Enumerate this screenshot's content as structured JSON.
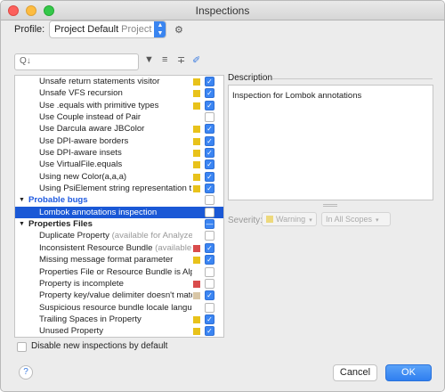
{
  "window": {
    "title": "Inspections"
  },
  "profile": {
    "label": "Profile:",
    "value": "Project Default",
    "sub": "Project"
  },
  "icons": {
    "gear": "gear-icon",
    "search": "search-icon",
    "filter": "filter-icon",
    "expand": "expand-all-icon",
    "collapse": "collapse-all-icon",
    "reset": "eraser-icon"
  },
  "toolbar": {
    "search_prefix": "Q↓",
    "filter_glyph": "▼",
    "expand_glyph": "≡",
    "collapse_glyph": "∓",
    "reset_glyph": "✐"
  },
  "colors": {
    "warning": "#e8c21b",
    "error": "#d94c4c",
    "weak_warning": "#d8c6a6",
    "selection": "#1a58d6",
    "group_link": "#1f5ae0",
    "accent": "#3b85f2"
  },
  "tree": [
    {
      "type": "item",
      "label": "Unsafe return statements visitor",
      "severity": "warning",
      "checked": true
    },
    {
      "type": "item",
      "label": "Unsafe VFS recursion",
      "severity": "warning",
      "checked": true
    },
    {
      "type": "item",
      "label": "Use .equals with primitive types",
      "severity": "warning",
      "checked": true
    },
    {
      "type": "item",
      "label": "Use Couple instead of Pair",
      "severity": "",
      "checked": false
    },
    {
      "type": "item",
      "label": "Use Darcula aware JBColor",
      "severity": "warning",
      "checked": true
    },
    {
      "type": "item",
      "label": "Use DPI-aware borders",
      "severity": "warning",
      "checked": true
    },
    {
      "type": "item",
      "label": "Use DPI-aware insets",
      "severity": "warning",
      "checked": true
    },
    {
      "type": "item",
      "label": "Use VirtualFile.equals",
      "severity": "warning",
      "checked": true
    },
    {
      "type": "item",
      "label": "Using new Color(a,a,a)",
      "severity": "warning",
      "checked": true
    },
    {
      "type": "item",
      "label": "Using PsiElement string representation t",
      "severity": "warning",
      "checked": true
    },
    {
      "type": "group",
      "label": "Probable bugs",
      "style": "blue",
      "checked": false
    },
    {
      "type": "item",
      "label": "Lombok annotations inspection",
      "severity": "",
      "checked": false,
      "selected": true
    },
    {
      "type": "group",
      "label": "Properties Files",
      "style": "normal",
      "checked": "partial"
    },
    {
      "type": "item",
      "label": "Duplicate Property",
      "hint": " (available for Analyze",
      "severity": "",
      "checked": false
    },
    {
      "type": "item",
      "label": "Inconsistent Resource Bundle",
      "hint": " (available f",
      "severity": "error",
      "checked": true
    },
    {
      "type": "item",
      "label": "Missing message format parameter",
      "severity": "warning",
      "checked": true
    },
    {
      "type": "item",
      "label": "Properties File or Resource Bundle is Alp",
      "severity": "",
      "checked": false
    },
    {
      "type": "item",
      "label": "Property is incomplete",
      "severity": "error",
      "checked": false
    },
    {
      "type": "item",
      "label": "Property key/value delimiter doesn't matc",
      "severity": "weak_warning",
      "checked": true
    },
    {
      "type": "item",
      "label": "Suspicious resource bundle locale langua",
      "severity": "",
      "checked": false
    },
    {
      "type": "item",
      "label": "Trailing Spaces in Property",
      "severity": "warning",
      "checked": true
    },
    {
      "type": "item",
      "label": "Unused Property",
      "severity": "warning",
      "checked": true
    }
  ],
  "description": {
    "label": "Description",
    "text": "Inspection for Lombok annotations"
  },
  "severity": {
    "label": "Severity:",
    "value": "Warning",
    "scope": "In All Scopes",
    "caret": "▾"
  },
  "footer": {
    "disable_new_label": "Disable new inspections by default",
    "help": "?",
    "cancel": "Cancel",
    "ok": "OK"
  }
}
